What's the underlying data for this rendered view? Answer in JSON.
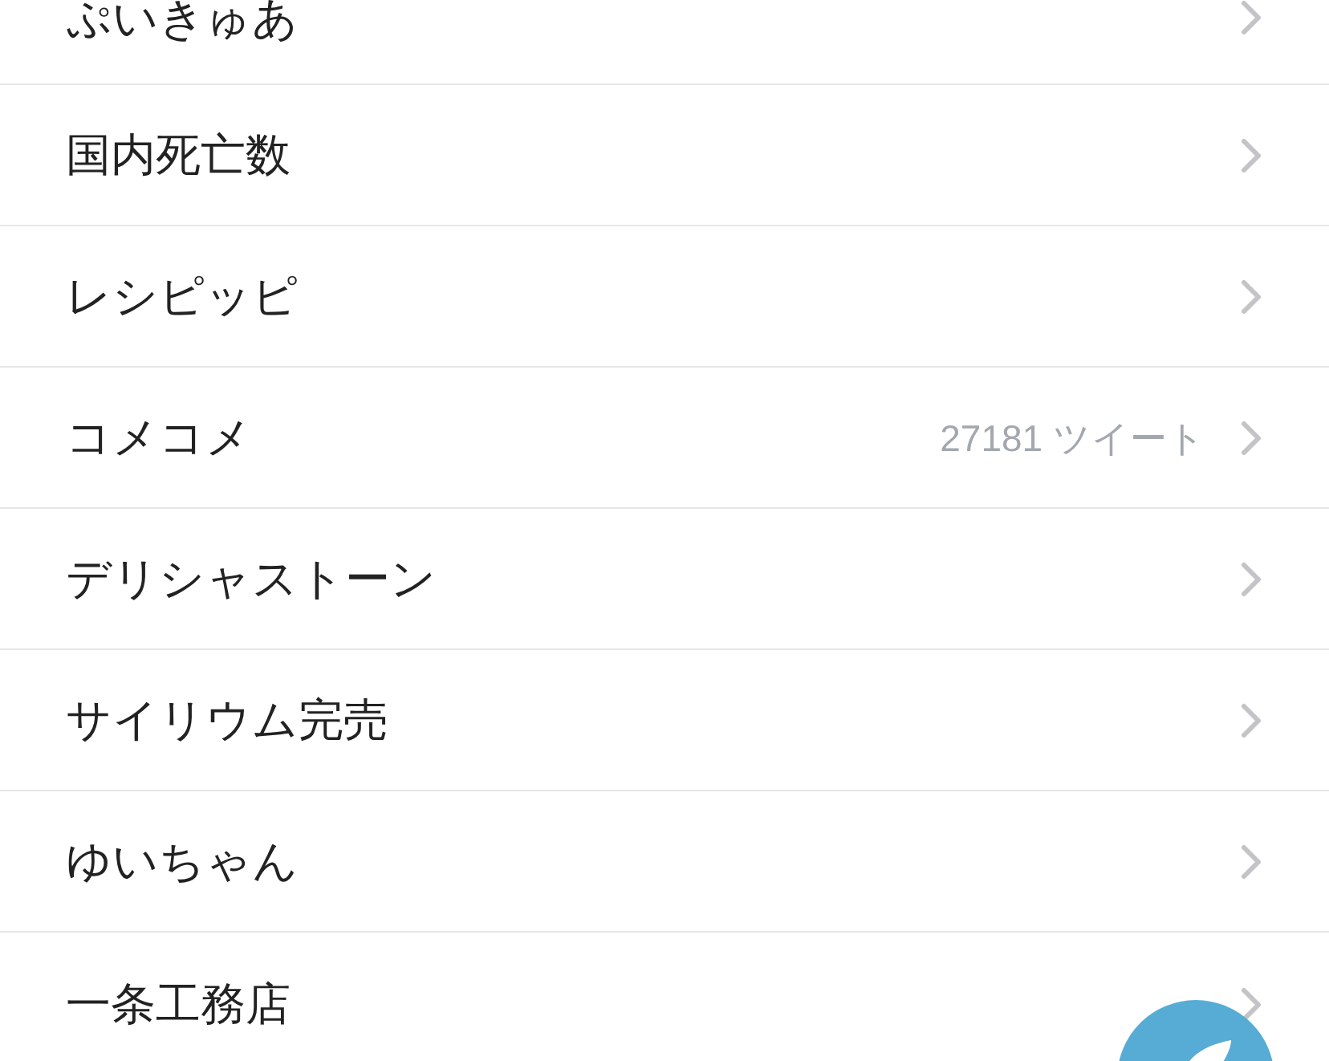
{
  "trends": [
    {
      "name": "ぷいきゅあ"
    },
    {
      "name": "国内死亡数"
    },
    {
      "name": "レシピッピ"
    },
    {
      "name": "コメコメ",
      "tweet_count": "27181 ツイート"
    },
    {
      "name": "デリシャストーン"
    },
    {
      "name": "サイリウム完売"
    },
    {
      "name": "ゆいちゃん"
    },
    {
      "name": "一条工務店"
    }
  ]
}
